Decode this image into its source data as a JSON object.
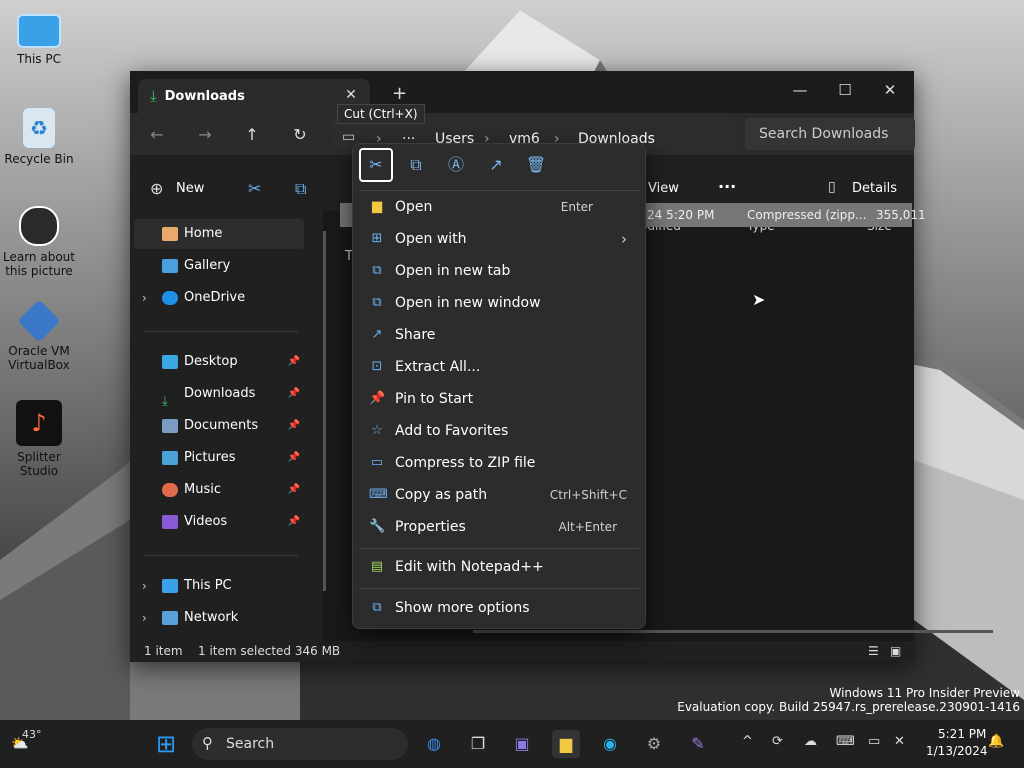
{
  "desktop": {
    "icons": [
      {
        "label": "This PC"
      },
      {
        "label": "Recycle Bin"
      },
      {
        "label": "Learn about this picture"
      },
      {
        "label": "Oracle VM VirtualBox"
      },
      {
        "label": "Splitter Studio"
      }
    ]
  },
  "explorer": {
    "tab_title": "Downloads",
    "tab_close": "✕",
    "new_tab": "+",
    "controls": {
      "minimize": "—",
      "maximize": "☐",
      "close": "✕"
    },
    "breadcrumb": [
      "Users",
      "vm6",
      "Downloads"
    ],
    "breadcrumb_more": "···",
    "search_placeholder": "Search Downloads",
    "toolbar": {
      "new": "New",
      "view": "View",
      "more": "···",
      "details": "Details"
    },
    "tooltip": "Cut (Ctrl+X)",
    "sidebar": {
      "home": "Home",
      "gallery": "Gallery",
      "onedrive": "OneDrive",
      "desktop": "Desktop",
      "downloads": "Downloads",
      "documents": "Documents",
      "pictures": "Pictures",
      "music": "Music",
      "videos": "Videos",
      "thispc": "This PC",
      "network": "Network"
    },
    "columns": {
      "modified": "odified",
      "type": "Type",
      "size": "Size"
    },
    "group_letter": "T",
    "file_row": {
      "date": "24 5:20 PM",
      "type": "Compressed (zipp...",
      "size": "355,011"
    },
    "status": {
      "count": "1 item",
      "selected": "1 item selected  346 MB"
    }
  },
  "context_menu": {
    "quick_actions": [
      "cut",
      "copy",
      "rename",
      "share",
      "delete"
    ],
    "items": [
      {
        "label": "Open",
        "shortcut": "Enter",
        "icon": "folder-icon"
      },
      {
        "label": "Open with",
        "shortcut": "",
        "icon": "open-with-icon"
      },
      {
        "label": "Open in new tab",
        "shortcut": "",
        "icon": "new-tab-icon"
      },
      {
        "label": "Open in new window",
        "shortcut": "",
        "icon": "new-window-icon"
      },
      {
        "label": "Share",
        "shortcut": "",
        "icon": "share-icon"
      },
      {
        "label": "Extract All...",
        "shortcut": "",
        "icon": "extract-icon"
      },
      {
        "label": "Pin to Start",
        "shortcut": "",
        "icon": "pin-icon"
      },
      {
        "label": "Add to Favorites",
        "shortcut": "",
        "icon": "star-icon"
      },
      {
        "label": "Compress to ZIP file",
        "shortcut": "",
        "icon": "zip-icon"
      },
      {
        "label": "Copy as path",
        "shortcut": "Ctrl+Shift+C",
        "icon": "path-icon"
      },
      {
        "label": "Properties",
        "shortcut": "Alt+Enter",
        "icon": "wrench-icon"
      },
      {
        "label": "Edit with Notepad++",
        "shortcut": "",
        "icon": "notepad-icon"
      },
      {
        "label": "Show more options",
        "shortcut": "",
        "icon": "more-options-icon"
      }
    ]
  },
  "watermark": {
    "line1": "Windows 11 Pro Insider Preview",
    "line2": "Evaluation copy. Build 25947.rs_prerelease.230901-1416"
  },
  "taskbar": {
    "weather": "43°",
    "search": "Search",
    "time": "5:21 PM",
    "date": "1/13/2024",
    "tray_chevron": "^"
  }
}
